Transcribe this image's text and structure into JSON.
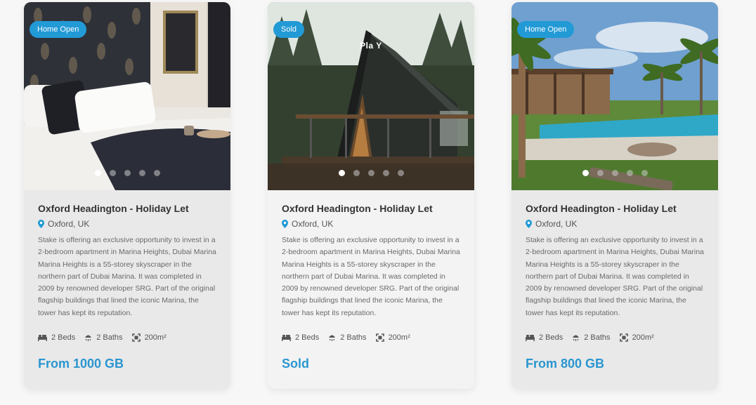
{
  "colors": {
    "accent": "#229ad6",
    "price": "#2a96d0",
    "text": "#333333"
  },
  "cards": [
    {
      "badge": "Home Open",
      "overlay": "",
      "title": "Oxford Headington - Holiday Let",
      "location": "Oxford, UK",
      "description": "Stake is offering an exclusive opportunity to invest in a 2-bedroom apartment in Marina Heights, Dubai Marina Marina Heights is a 55-storey skyscraper in the northern part of Dubai Marina. It was completed in 2009 by renowned developer SRG. Part of the original flagship buildings that lined the iconic Marina, the tower has kept its reputation.",
      "beds": "2 Beds",
      "baths": "2 Baths",
      "area": "200m²",
      "price": "From 1000 GB",
      "image_icon": "bedroom-photo",
      "carousel_active": 0
    },
    {
      "badge": "Sold",
      "overlay": "Pla Y",
      "title": "Oxford Headington - Holiday Let",
      "location": "Oxford, UK",
      "description": "Stake is offering an exclusive opportunity to invest in a 2-bedroom apartment in Marina Heights, Dubai Marina Marina Heights is a 55-storey skyscraper in the northern part of Dubai Marina. It was completed in 2009 by renowned developer SRG. Part of the original flagship buildings that lined the iconic Marina, the tower has kept its reputation.",
      "beds": "2 Beds",
      "baths": "2 Baths",
      "area": "200m²",
      "price": "Sold",
      "image_icon": "a-frame-cabin-photo",
      "carousel_active": 0
    },
    {
      "badge": "Home Open",
      "overlay": "",
      "title": "Oxford Headington - Holiday Let",
      "location": "Oxford, UK",
      "description": "Stake is offering an exclusive opportunity to invest in a 2-bedroom apartment in Marina Heights, Dubai Marina Marina Heights is a 55-storey skyscraper in the northern part of Dubai Marina. It was completed in 2009 by renowned developer SRG. Part of the original flagship buildings that lined the iconic Marina, the tower has kept its reputation.",
      "beds": "2 Beds",
      "baths": "2 Baths",
      "area": "200m²",
      "price": "From 800 GB",
      "image_icon": "tropical-villa-pool-photo",
      "carousel_active": 0
    }
  ]
}
